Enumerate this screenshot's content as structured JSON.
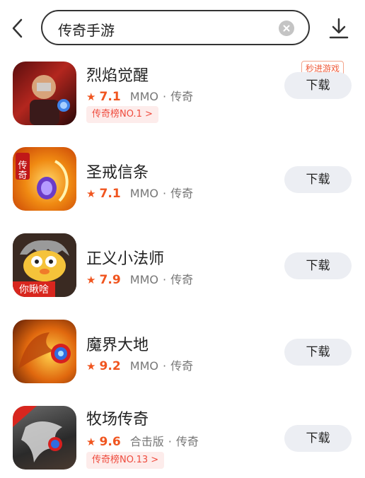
{
  "search": {
    "query": "传奇手游"
  },
  "icons": {
    "back": "chevron-left-icon",
    "clear": "clear-circle-icon",
    "download": "download-icon"
  },
  "colors": {
    "accent": "#f0551f",
    "tag_bg": "#fdeceb",
    "button_bg": "#eceef3"
  },
  "apps": [
    {
      "name": "烈焰觉醒",
      "rating": "7.1",
      "category": "MMO",
      "genre": "传奇",
      "rank_tag": "传奇榜NO.1 >",
      "promo_tag": "秒进游戏",
      "button": "下载"
    },
    {
      "name": "圣戒信条",
      "rating": "7.1",
      "category": "MMO",
      "genre": "传奇",
      "button": "下载"
    },
    {
      "name": "正义小法师",
      "rating": "7.9",
      "category": "MMO",
      "genre": "传奇",
      "button": "下载"
    },
    {
      "name": "魔界大地",
      "rating": "9.2",
      "category": "MMO",
      "genre": "传奇",
      "button": "下载"
    },
    {
      "name": "牧场传奇",
      "rating": "9.6",
      "category": "合击版",
      "genre": "传奇",
      "rank_tag": "传奇榜NO.13 >",
      "button": "下载"
    }
  ]
}
